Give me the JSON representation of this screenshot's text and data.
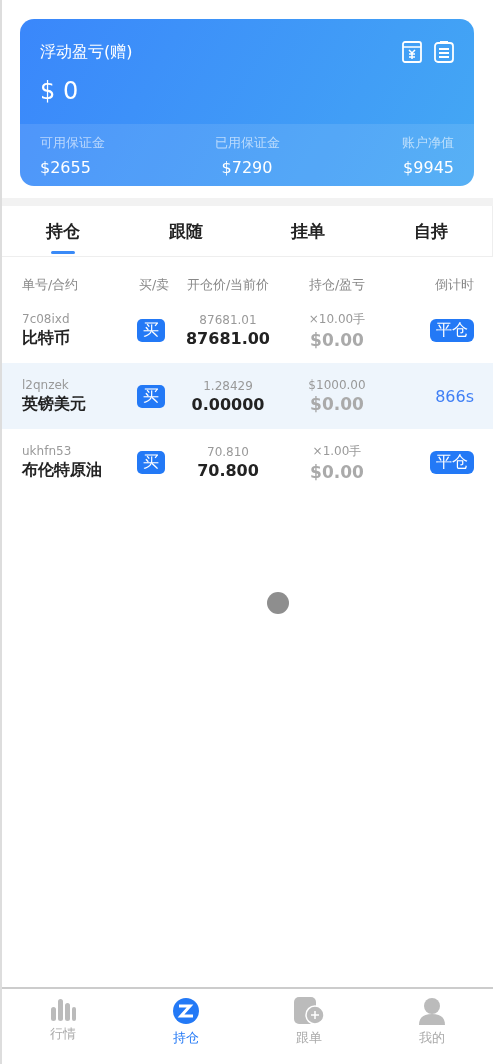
{
  "summary_card": {
    "title": "浮动盈亏(赠)",
    "value": "$ 0",
    "stats": [
      {
        "label": "可用保证金",
        "value": "$2655"
      },
      {
        "label": "已用保证金",
        "value": "$7290"
      },
      {
        "label": "账户净值",
        "value": "$9945"
      }
    ]
  },
  "tabs": [
    {
      "label": "持仓",
      "selected": true
    },
    {
      "label": "跟随",
      "selected": false
    },
    {
      "label": "挂单",
      "selected": false
    },
    {
      "label": "自持",
      "selected": false
    }
  ],
  "table": {
    "columns": [
      "单号/合约",
      "买/卖",
      "开仓价/当前价",
      "持仓/盈亏",
      "倒计时"
    ],
    "rows": [
      {
        "id": "7c08ixd",
        "name": "比特币",
        "side": "买",
        "open_price": "87681.01",
        "current_price": "87681.00",
        "holding": "×10.00手",
        "pnl": "$0.00",
        "action": {
          "kind": "button",
          "label": "平仓"
        },
        "selected": false
      },
      {
        "id": "l2qnzek",
        "name": "英镑美元",
        "side": "买",
        "open_price": "1.28429",
        "current_price": "0.00000",
        "holding": "$1000.00",
        "pnl": "$0.00",
        "action": {
          "kind": "countdown",
          "label": "866s"
        },
        "selected": true
      },
      {
        "id": "ukhfn53",
        "name": "布伦特原油",
        "side": "买",
        "open_price": "70.810",
        "current_price": "70.800",
        "holding": "×1.00手",
        "pnl": "$0.00",
        "action": {
          "kind": "button",
          "label": "平仓"
        },
        "selected": false
      }
    ]
  },
  "bottom_nav": [
    {
      "label": "行情",
      "selected": false
    },
    {
      "label": "持仓",
      "selected": true
    },
    {
      "label": "跟单",
      "selected": false
    },
    {
      "label": "我的",
      "selected": false
    }
  ]
}
